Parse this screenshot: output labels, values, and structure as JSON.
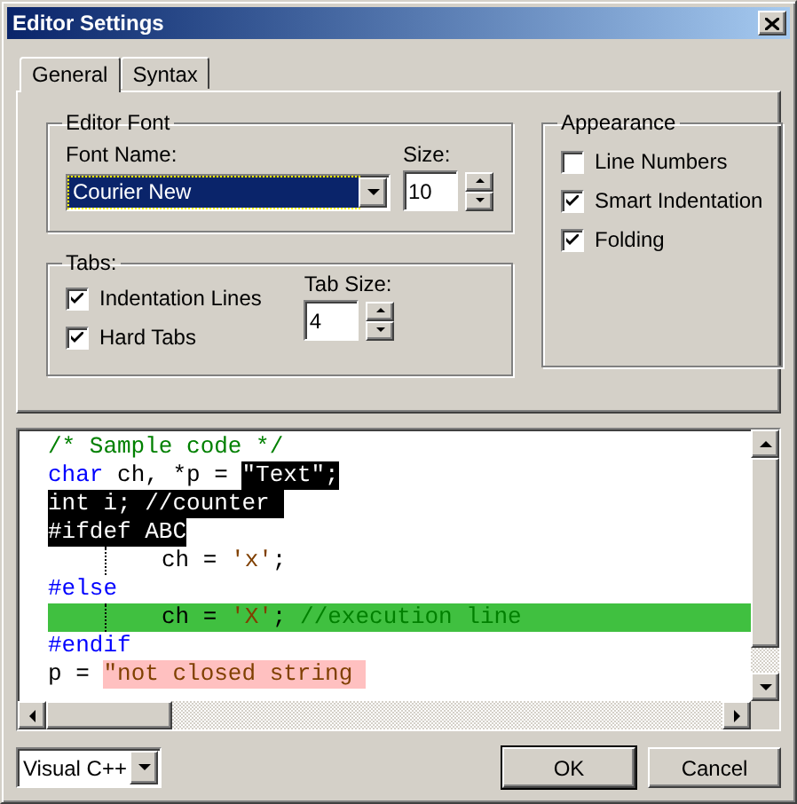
{
  "window": {
    "title": "Editor Settings"
  },
  "tabs": [
    {
      "label": "General",
      "selected": true
    },
    {
      "label": "Syntax",
      "selected": false
    }
  ],
  "editor_font": {
    "title": "Editor Font",
    "font_name_label": "Font Name:",
    "font_name": "Courier New",
    "size_label": "Size:",
    "size": "10"
  },
  "tabs_group": {
    "title": "Tabs:",
    "options": [
      {
        "label": "Indentation Lines",
        "checked": true
      },
      {
        "label": "Hard Tabs",
        "checked": true
      }
    ],
    "tab_size_label": "Tab Size:",
    "tab_size": "4"
  },
  "appearance": {
    "title": "Appearance",
    "options": [
      {
        "label": "Line Numbers",
        "checked": false
      },
      {
        "label": "Smart Indentation",
        "checked": true
      },
      {
        "label": "Folding",
        "checked": true
      }
    ]
  },
  "code_lines": [
    {
      "kind": "normal",
      "indented": false,
      "tokens": [
        {
          "kind": "comment",
          "text": "/* Sample code */",
          "selected": false
        }
      ]
    },
    {
      "kind": "normal",
      "indented": false,
      "tokens": [
        {
          "kind": "keyword",
          "text": "char",
          "selected": false
        },
        {
          "kind": "text",
          "text": " ch, *p = ",
          "selected": false
        },
        {
          "kind": "string",
          "text": "\"Text\";",
          "selected": true
        }
      ]
    },
    {
      "kind": "normal",
      "indented": false,
      "tokens": [
        {
          "kind": "text",
          "text": "int i; //counter ",
          "selected": true
        }
      ]
    },
    {
      "kind": "normal",
      "indented": false,
      "tokens": [
        {
          "kind": "keyword",
          "text": "#ifdef ABC",
          "selected": true
        }
      ]
    },
    {
      "kind": "normal",
      "indented": true,
      "tokens": [
        {
          "kind": "text",
          "text": "ch = ",
          "selected": false
        },
        {
          "kind": "string",
          "text": "'x'",
          "selected": false
        },
        {
          "kind": "text",
          "text": ";",
          "selected": false
        }
      ]
    },
    {
      "kind": "normal",
      "indented": false,
      "tokens": [
        {
          "kind": "keyword",
          "text": "#else",
          "selected": false
        }
      ]
    },
    {
      "kind": "execution",
      "indented": true,
      "tokens": [
        {
          "kind": "text",
          "text": "ch = ",
          "selected": false
        },
        {
          "kind": "string",
          "text": "'X'",
          "selected": false
        },
        {
          "kind": "text",
          "text": "; ",
          "selected": false
        },
        {
          "kind": "comment",
          "text": "//execution line",
          "selected": false
        }
      ]
    },
    {
      "kind": "normal",
      "indented": false,
      "tokens": [
        {
          "kind": "keyword",
          "text": "#endif",
          "selected": false
        }
      ]
    },
    {
      "kind": "normal",
      "indented": false,
      "tokens": [
        {
          "kind": "text",
          "text": "p = ",
          "selected": false
        },
        {
          "kind": "error",
          "text": "\"not closed string ",
          "selected": false
        }
      ]
    }
  ],
  "language": "Visual C++",
  "buttons": [
    "OK",
    "Cancel"
  ]
}
